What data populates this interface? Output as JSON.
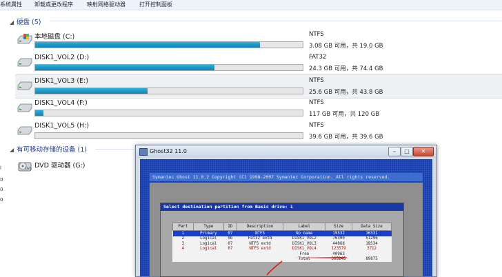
{
  "toolbar": {
    "items": [
      "系统属性",
      "卸载或更改程序",
      "映射网络驱动器",
      "打开控制面板"
    ]
  },
  "nav_stub": [
    "l",
    "0",
    "0",
    "0"
  ],
  "hard_disks": {
    "header": "硬盘 (5)",
    "drives": [
      {
        "name": "本地磁盘 (C:)",
        "fs": "NTFS",
        "space": "3.08 GB 可用，共 19.0 GB",
        "used_fraction": 0.84,
        "selected": false
      },
      {
        "name": "DISK1_VOL2 (D:)",
        "fs": "FAT32",
        "space": "24.3 GB 可用，共 74.4 GB",
        "used_fraction": 0.67,
        "selected": false
      },
      {
        "name": "DISK1_VOL3 (E:)",
        "fs": "NTFS",
        "space": "25.6 GB 可用，共 43.8 GB",
        "used_fraction": 0.42,
        "selected": true
      },
      {
        "name": "DISK1_VOL4 (F:)",
        "fs": "NTFS",
        "space": "117 GB 可用，共 120 GB",
        "used_fraction": 0.03,
        "selected": false
      },
      {
        "name": "DISK1_VOL5 (H:)",
        "fs": "NTFS",
        "space": "39.6 GB 可用，共 39.6 GB",
        "used_fraction": 0.0,
        "selected": false
      }
    ]
  },
  "removable": {
    "header": "有可移动存储的设备 (1)",
    "dvd_name": "DVD 驱动器 (G:)"
  },
  "ghost": {
    "title": "Ghost32 11.0",
    "banner": "Symantec Ghost 11.0.2   Copyright (C) 1998-2007 Symantec Corporation. All rights reserved.",
    "dialog_title": "Select destination partition from Basic drive: 1",
    "columns": [
      "Part",
      "Type",
      "ID",
      "Description",
      "Label",
      "Size",
      "Data Size"
    ],
    "rows": [
      {
        "part": "1",
        "type": "Primary",
        "id": "07",
        "desc": "NTFS",
        "label": "No name",
        "size": "19532",
        "data": "16331",
        "style": "sel"
      },
      {
        "part": "2",
        "type": "Logical",
        "id": "0b",
        "desc": "Fat32 extd",
        "label": "DISK1_VOL2",
        "size": "76300",
        "data": "51296",
        "style": ""
      },
      {
        "part": "3",
        "type": "Logical",
        "id": "07",
        "desc": "NTFS extd",
        "label": "DISK1_VOL3",
        "size": "44868",
        "data": "18534",
        "style": ""
      },
      {
        "part": "4",
        "type": "Logical",
        "id": "07",
        "desc": "NTFS extd",
        "label": "DISK1_VOL4",
        "size": "123579",
        "data": "3712",
        "style": "red"
      },
      {
        "part": "",
        "type": "",
        "id": "",
        "desc": "",
        "label": "Free",
        "size": "40963",
        "data": "",
        "style": ""
      },
      {
        "part": "",
        "type": "",
        "id": "",
        "desc": "",
        "label": "Total",
        "size": "305245",
        "data": "89875",
        "style": ""
      }
    ]
  },
  "colors": {
    "accent": "#1e3d8f",
    "bar_fill": "#1a96c8",
    "ghost_blue": "#1a3fa8"
  }
}
